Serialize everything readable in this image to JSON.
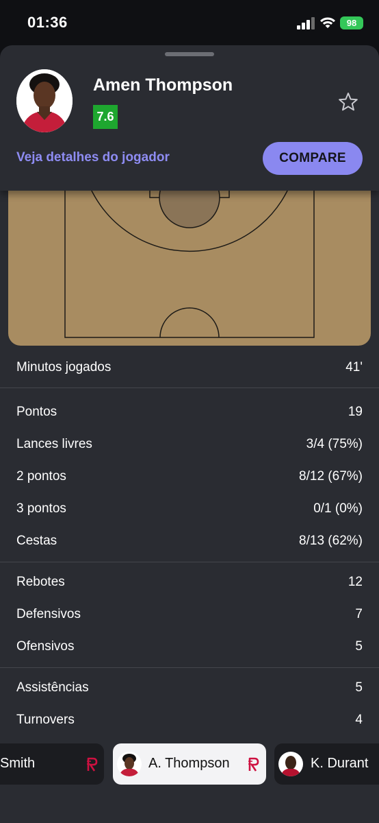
{
  "status_bar": {
    "time": "01:36",
    "battery": "98"
  },
  "player": {
    "name": "Amen Thompson",
    "rating": "7.6",
    "details_link": "Veja detalhes do jogador",
    "compare_label": "COMPARE"
  },
  "stats": {
    "minutes": {
      "label": "Minutos jogados",
      "value": "41'"
    },
    "scoring": [
      {
        "label": "Pontos",
        "value": "19"
      },
      {
        "label": "Lances livres",
        "value": "3/4 (75%)"
      },
      {
        "label": "2 pontos",
        "value": "8/12 (67%)"
      },
      {
        "label": "3 pontos",
        "value": "0/1 (0%)"
      },
      {
        "label": "Cestas",
        "value": "8/13 (62%)"
      }
    ],
    "rebounds": [
      {
        "label": "Rebotes",
        "value": "12"
      },
      {
        "label": "Defensivos",
        "value": "7"
      },
      {
        "label": "Ofensivos",
        "value": "5"
      }
    ],
    "other": [
      {
        "label": "Assistências",
        "value": "5"
      },
      {
        "label": "Turnovers",
        "value": "4"
      }
    ]
  },
  "player_strip": {
    "left": "Smith",
    "active": "A. Thompson",
    "right": "K. Durant"
  },
  "colors": {
    "accent": "#8a88f0",
    "rating_green": "#1ea72f",
    "court": "#a88c61",
    "rockets_red": "#ce1141"
  }
}
